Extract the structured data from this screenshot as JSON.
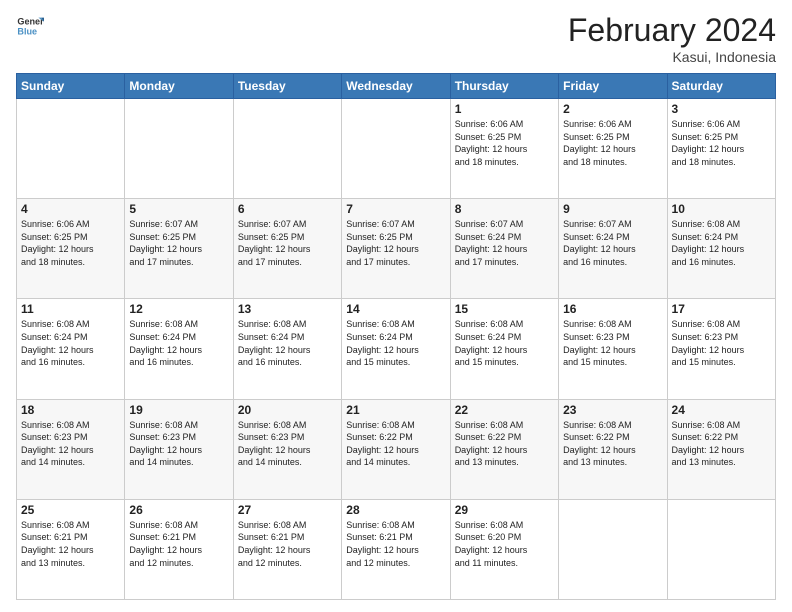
{
  "header": {
    "logo_line1": "General",
    "logo_line2": "Blue",
    "month_year": "February 2024",
    "location": "Kasui, Indonesia"
  },
  "weekdays": [
    "Sunday",
    "Monday",
    "Tuesday",
    "Wednesday",
    "Thursday",
    "Friday",
    "Saturday"
  ],
  "weeks": [
    [
      {
        "day": "",
        "info": ""
      },
      {
        "day": "",
        "info": ""
      },
      {
        "day": "",
        "info": ""
      },
      {
        "day": "",
        "info": ""
      },
      {
        "day": "1",
        "info": "Sunrise: 6:06 AM\nSunset: 6:25 PM\nDaylight: 12 hours\nand 18 minutes."
      },
      {
        "day": "2",
        "info": "Sunrise: 6:06 AM\nSunset: 6:25 PM\nDaylight: 12 hours\nand 18 minutes."
      },
      {
        "day": "3",
        "info": "Sunrise: 6:06 AM\nSunset: 6:25 PM\nDaylight: 12 hours\nand 18 minutes."
      }
    ],
    [
      {
        "day": "4",
        "info": "Sunrise: 6:06 AM\nSunset: 6:25 PM\nDaylight: 12 hours\nand 18 minutes."
      },
      {
        "day": "5",
        "info": "Sunrise: 6:07 AM\nSunset: 6:25 PM\nDaylight: 12 hours\nand 17 minutes."
      },
      {
        "day": "6",
        "info": "Sunrise: 6:07 AM\nSunset: 6:25 PM\nDaylight: 12 hours\nand 17 minutes."
      },
      {
        "day": "7",
        "info": "Sunrise: 6:07 AM\nSunset: 6:25 PM\nDaylight: 12 hours\nand 17 minutes."
      },
      {
        "day": "8",
        "info": "Sunrise: 6:07 AM\nSunset: 6:24 PM\nDaylight: 12 hours\nand 17 minutes."
      },
      {
        "day": "9",
        "info": "Sunrise: 6:07 AM\nSunset: 6:24 PM\nDaylight: 12 hours\nand 16 minutes."
      },
      {
        "day": "10",
        "info": "Sunrise: 6:08 AM\nSunset: 6:24 PM\nDaylight: 12 hours\nand 16 minutes."
      }
    ],
    [
      {
        "day": "11",
        "info": "Sunrise: 6:08 AM\nSunset: 6:24 PM\nDaylight: 12 hours\nand 16 minutes."
      },
      {
        "day": "12",
        "info": "Sunrise: 6:08 AM\nSunset: 6:24 PM\nDaylight: 12 hours\nand 16 minutes."
      },
      {
        "day": "13",
        "info": "Sunrise: 6:08 AM\nSunset: 6:24 PM\nDaylight: 12 hours\nand 16 minutes."
      },
      {
        "day": "14",
        "info": "Sunrise: 6:08 AM\nSunset: 6:24 PM\nDaylight: 12 hours\nand 15 minutes."
      },
      {
        "day": "15",
        "info": "Sunrise: 6:08 AM\nSunset: 6:24 PM\nDaylight: 12 hours\nand 15 minutes."
      },
      {
        "day": "16",
        "info": "Sunrise: 6:08 AM\nSunset: 6:23 PM\nDaylight: 12 hours\nand 15 minutes."
      },
      {
        "day": "17",
        "info": "Sunrise: 6:08 AM\nSunset: 6:23 PM\nDaylight: 12 hours\nand 15 minutes."
      }
    ],
    [
      {
        "day": "18",
        "info": "Sunrise: 6:08 AM\nSunset: 6:23 PM\nDaylight: 12 hours\nand 14 minutes."
      },
      {
        "day": "19",
        "info": "Sunrise: 6:08 AM\nSunset: 6:23 PM\nDaylight: 12 hours\nand 14 minutes."
      },
      {
        "day": "20",
        "info": "Sunrise: 6:08 AM\nSunset: 6:23 PM\nDaylight: 12 hours\nand 14 minutes."
      },
      {
        "day": "21",
        "info": "Sunrise: 6:08 AM\nSunset: 6:22 PM\nDaylight: 12 hours\nand 14 minutes."
      },
      {
        "day": "22",
        "info": "Sunrise: 6:08 AM\nSunset: 6:22 PM\nDaylight: 12 hours\nand 13 minutes."
      },
      {
        "day": "23",
        "info": "Sunrise: 6:08 AM\nSunset: 6:22 PM\nDaylight: 12 hours\nand 13 minutes."
      },
      {
        "day": "24",
        "info": "Sunrise: 6:08 AM\nSunset: 6:22 PM\nDaylight: 12 hours\nand 13 minutes."
      }
    ],
    [
      {
        "day": "25",
        "info": "Sunrise: 6:08 AM\nSunset: 6:21 PM\nDaylight: 12 hours\nand 13 minutes."
      },
      {
        "day": "26",
        "info": "Sunrise: 6:08 AM\nSunset: 6:21 PM\nDaylight: 12 hours\nand 12 minutes."
      },
      {
        "day": "27",
        "info": "Sunrise: 6:08 AM\nSunset: 6:21 PM\nDaylight: 12 hours\nand 12 minutes."
      },
      {
        "day": "28",
        "info": "Sunrise: 6:08 AM\nSunset: 6:21 PM\nDaylight: 12 hours\nand 12 minutes."
      },
      {
        "day": "29",
        "info": "Sunrise: 6:08 AM\nSunset: 6:20 PM\nDaylight: 12 hours\nand 11 minutes."
      },
      {
        "day": "",
        "info": ""
      },
      {
        "day": "",
        "info": ""
      }
    ]
  ]
}
